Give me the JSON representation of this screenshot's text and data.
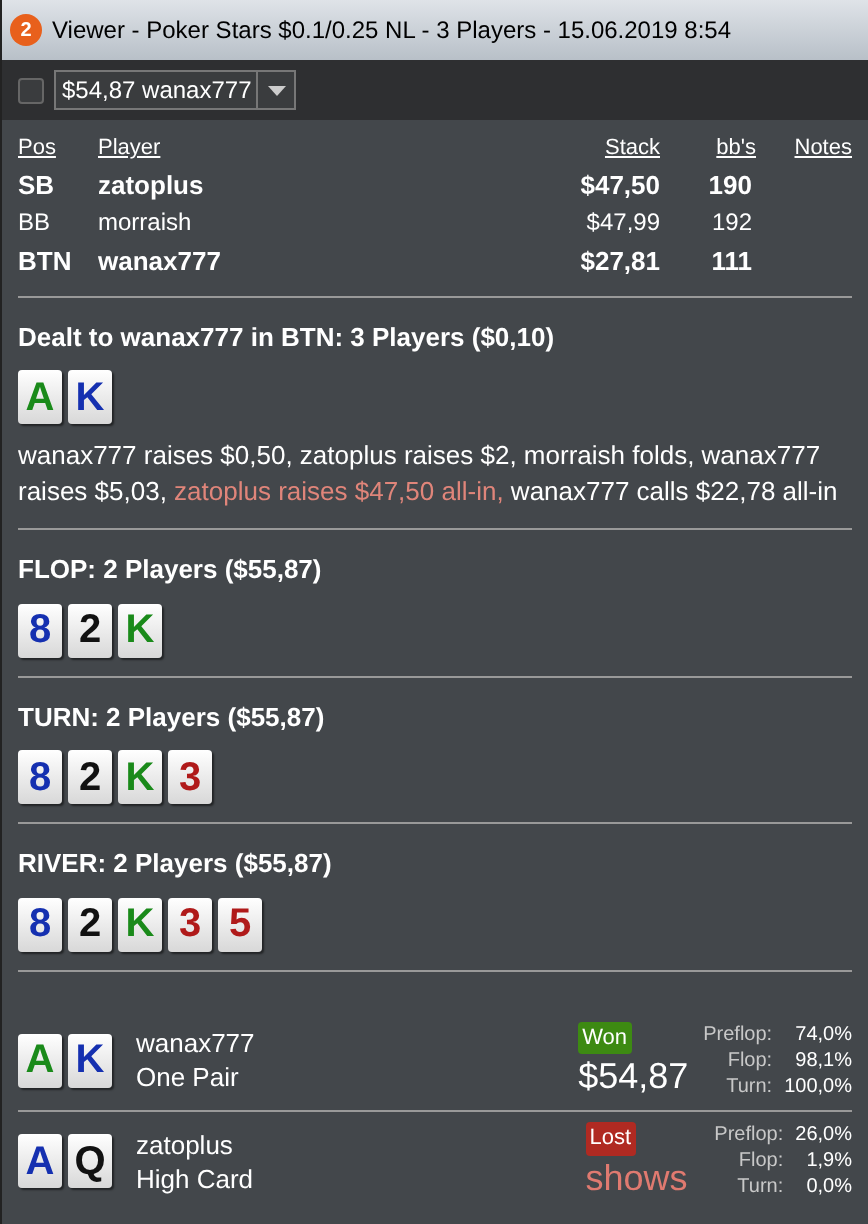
{
  "window": {
    "badge": "2",
    "title": "Viewer - Poker Stars $0.1/0.25 NL - 3 Players - 15.06.2019 8:54"
  },
  "toolbar": {
    "checked": false,
    "hand_select": "$54,87 wanax777"
  },
  "table": {
    "columns": [
      "Pos",
      "Player",
      "Stack",
      "bb's",
      "Notes"
    ],
    "rows": [
      {
        "pos": "SB",
        "player": "zatoplus",
        "stack": "$47,50",
        "bbs": "190",
        "highlighted": true
      },
      {
        "pos": "BB",
        "player": "morraish",
        "stack": "$47,99",
        "bbs": "192",
        "highlighted": false
      },
      {
        "pos": "BTN",
        "player": "wanax777",
        "stack": "$27,81",
        "bbs": "111",
        "highlighted": true
      }
    ]
  },
  "streets": [
    {
      "header": "Dealt to wanax777 in BTN: 3 Players ($0,10)",
      "cards": [
        {
          "rank": "A",
          "color": "#1a8a1a"
        },
        {
          "rank": "K",
          "color": "#1530b0"
        }
      ],
      "actions": [
        {
          "text": "wanax777 raises $0,50, zatoplus raises $2, morraish folds, wanax777 raises $5,03, ",
          "highlight": false
        },
        {
          "text": "zatoplus raises $47,50 all-in,",
          "highlight": true
        },
        {
          "text": " wanax777 calls $22,78 all-in",
          "highlight": false
        }
      ]
    },
    {
      "header": "FLOP: 2 Players ($55,87)",
      "cards": [
        {
          "rank": "8",
          "color": "#1530b0"
        },
        {
          "rank": "2",
          "color": "#111111"
        },
        {
          "rank": "K",
          "color": "#1a8a1a"
        }
      ]
    },
    {
      "header": "TURN: 2 Players ($55,87)",
      "cards": [
        {
          "rank": "8",
          "color": "#1530b0"
        },
        {
          "rank": "2",
          "color": "#111111"
        },
        {
          "rank": "K",
          "color": "#1a8a1a"
        },
        {
          "rank": "3",
          "color": "#b01a1a"
        }
      ]
    },
    {
      "header": "RIVER: 2 Players ($55,87)",
      "cards": [
        {
          "rank": "8",
          "color": "#1530b0"
        },
        {
          "rank": "2",
          "color": "#111111"
        },
        {
          "rank": "K",
          "color": "#1a8a1a"
        },
        {
          "rank": "3",
          "color": "#b01a1a"
        },
        {
          "rank": "5",
          "color": "#b01a1a"
        }
      ]
    }
  ],
  "results": [
    {
      "cards": [
        {
          "rank": "A",
          "color": "#1a8a1a"
        },
        {
          "rank": "K",
          "color": "#1530b0"
        }
      ],
      "player": "wanax777",
      "hand": "One Pair",
      "won": true,
      "badge": "Won",
      "amount": "$54,87",
      "equity": [
        {
          "label": "Preflop:",
          "value": "74,0%"
        },
        {
          "label": "Flop:",
          "value": "98,1%"
        },
        {
          "label": "Turn:",
          "value": "100,0%"
        }
      ]
    },
    {
      "cards": [
        {
          "rank": "A",
          "color": "#1530b0"
        },
        {
          "rank": "Q",
          "color": "#111111"
        }
      ],
      "player": "zatoplus",
      "hand": "High Card",
      "won": false,
      "badge": "Lost",
      "amount": "shows",
      "equity": [
        {
          "label": "Preflop:",
          "value": "26,0%"
        },
        {
          "label": "Flop:",
          "value": "1,9%"
        },
        {
          "label": "Turn:",
          "value": "0,0%"
        }
      ]
    }
  ]
}
